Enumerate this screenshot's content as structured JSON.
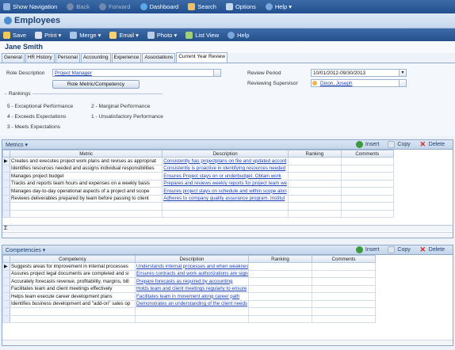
{
  "topnav": {
    "items": [
      {
        "label": "Show Navigation",
        "icon": "nav-icon"
      },
      {
        "label": "Back",
        "icon": "back-arrow-icon"
      },
      {
        "label": "Forward",
        "icon": "forward-arrow-icon"
      },
      {
        "label": "Dashboard",
        "icon": "dashboard-icon"
      },
      {
        "label": "Search",
        "icon": "search-icon"
      },
      {
        "label": "Options",
        "icon": "options-icon"
      },
      {
        "label": "Help",
        "icon": "help-icon"
      }
    ]
  },
  "page_title": "Employees",
  "toolbar": {
    "items": [
      {
        "label": "Save",
        "icon": "save-icon"
      },
      {
        "label": "Print",
        "icon": "print-icon"
      },
      {
        "label": "Merge",
        "icon": "merge-icon"
      },
      {
        "label": "Email",
        "icon": "email-icon"
      },
      {
        "label": "Photo",
        "icon": "photo-icon"
      },
      {
        "label": "List View",
        "icon": "list-view-icon"
      },
      {
        "label": "Help",
        "icon": "help-icon"
      }
    ]
  },
  "employee_name": "Jane Smith",
  "tabs": [
    "General",
    "HR History",
    "Personal",
    "Accounting",
    "Experience",
    "Associations",
    "Current Year Review"
  ],
  "active_tab": "Current Year Review",
  "form": {
    "role_description_label": "Role Description",
    "role_description_value": "Project Manager",
    "role_metric_button": "Role Metric/Competency",
    "review_period_label": "Review Period",
    "review_period_value": "10/01/2012-09/30/2013",
    "reviewing_supervisor_label": "Reviewing Supervisor",
    "reviewing_supervisor_value": "Dixon, Joseph",
    "rankings_label": "Rankings",
    "rankings": [
      "5 - Exceptional Performance",
      "2 - Marginal Performance",
      "4 - Exceeds Expectations",
      "1 - Unsatisfactory Performance",
      "3 - Meets Expectations"
    ]
  },
  "metrics": {
    "title": "Metrics",
    "actions": {
      "insert": "Insert",
      "copy": "Copy",
      "delete": "Delete"
    },
    "columns": [
      "Metric",
      "Description",
      "Ranking",
      "Comments"
    ],
    "rows": [
      [
        "Creates and executes project work plans and revises as appropriat",
        "Consistently has projectplans on file and updated accord",
        "",
        ""
      ],
      [
        "Identifies resources needed and assigns individual responsibilities",
        "Consistently is proactive in identifying resources needed",
        "",
        ""
      ],
      [
        "Manages project budget",
        "Ensures Project stays on or underbudget.  Obtain work",
        "",
        ""
      ],
      [
        "Tracks and reports team hours and expenses on a weekly basis",
        "Prepares and reviews weekly reports for project team we",
        "",
        ""
      ],
      [
        "Manages day-to-day operational aspects of a project and scope",
        "Ensures project stays on schedule and within scope alon",
        "",
        ""
      ],
      [
        "Reviews deliverables prepared by team before passing to client",
        "Adheres to company quality assurance program.  Institut",
        "",
        ""
      ]
    ],
    "sum_symbol": "Σ"
  },
  "competencies": {
    "title": "Competencies",
    "actions": {
      "insert": "Insert",
      "copy": "Copy",
      "delete": "Delete"
    },
    "columns": [
      "Competency",
      "Description",
      "Ranking",
      "Comments"
    ],
    "rows": [
      [
        "Suggests areas for improvement in internal processes",
        "Understands internal processes and when weakness",
        "",
        ""
      ],
      [
        "Assures project legal documents are completed and si",
        "Ensures contracts and work authorizations are signe",
        "",
        ""
      ],
      [
        "Accurately forecasts revenue, profitability, margins, bill",
        "Prepare forecasts as required by accounting",
        "",
        ""
      ],
      [
        "Facilitates team and client meetings effectively",
        "Holds team and client meetings regularly to ensure",
        "",
        ""
      ],
      [
        "Helps team execute career development plans",
        "Facilitates team in movement along career path",
        "",
        ""
      ],
      [
        "Identifies business development and \"add-on\" sales op",
        "Demonstrates an understanding of the client needs",
        "",
        ""
      ]
    ]
  },
  "colors": {
    "nav_bar": "#2b5a98",
    "title_bar": "#d3e2f3",
    "link": "#1a3fb5",
    "delete": "#d21f1f",
    "insert": "#3c9a3c"
  }
}
